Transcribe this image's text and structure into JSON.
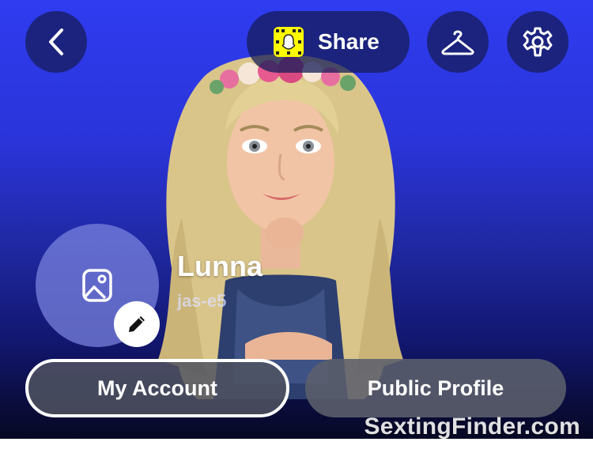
{
  "header": {
    "share_label": "Share",
    "icons": {
      "back": "chevron-left-icon",
      "snapcode": "snapcode-icon",
      "outfit": "hanger-icon",
      "settings": "gear-icon"
    }
  },
  "profile": {
    "display_name": "Lunna",
    "username": "jas-e5",
    "photo_icon": "image-icon",
    "edit_icon": "pencil-icon"
  },
  "actions": {
    "my_account_label": "My Account",
    "public_profile_label": "Public Profile"
  },
  "watermark": {
    "text": "SextingFinder.com"
  },
  "colors": {
    "background_top": "#2f3cf0",
    "background_bottom": "#05061a",
    "snapcode_yellow": "#fffc00",
    "button_dark": "#161c5a"
  }
}
